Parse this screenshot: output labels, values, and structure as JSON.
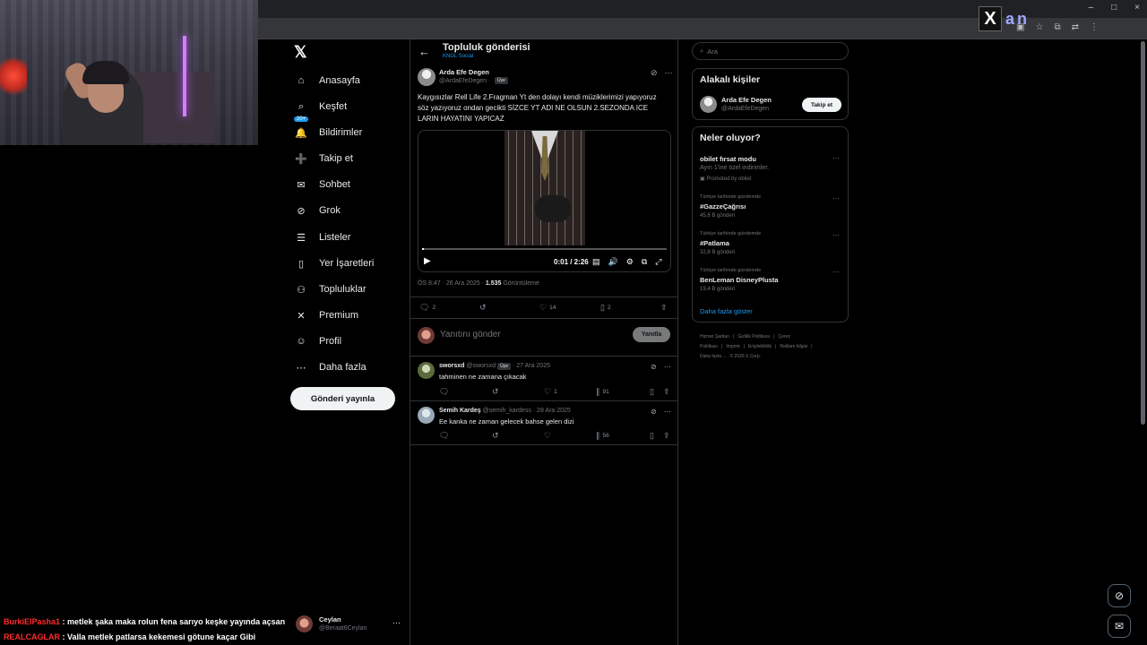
{
  "brand": {
    "xan_logo": "X",
    "xan_text": "an"
  },
  "window_controls": [
    "–",
    "□",
    "×"
  ],
  "ext_icons": [
    "▣",
    "☆",
    "⧉",
    "⇄",
    "⋮"
  ],
  "nav": {
    "logo": "𝕏",
    "items": [
      {
        "label": "Anasayfa",
        "icon": "home-icon",
        "glyph": "⌂"
      },
      {
        "label": "Keşfet",
        "icon": "search-icon",
        "glyph": "⌕"
      },
      {
        "label": "Bildirimler",
        "icon": "bell-icon",
        "glyph": "🔔",
        "badge": "20+"
      },
      {
        "label": "Takip et",
        "icon": "follow-icon",
        "glyph": "➕"
      },
      {
        "label": "Sohbet",
        "icon": "mail-icon",
        "glyph": "✉"
      },
      {
        "label": "Grok",
        "icon": "grok-icon",
        "glyph": "⊘"
      },
      {
        "label": "Listeler",
        "icon": "list-icon",
        "glyph": "☰"
      },
      {
        "label": "Yer İşaretleri",
        "icon": "bookmark-icon",
        "glyph": "▯"
      },
      {
        "label": "Topluluklar",
        "icon": "communities-icon",
        "glyph": "⚇"
      },
      {
        "label": "Premium",
        "icon": "x-premium-icon",
        "glyph": "✕"
      },
      {
        "label": "Profil",
        "icon": "profile-icon",
        "glyph": "☺"
      },
      {
        "label": "Daha fazla",
        "icon": "more-icon",
        "glyph": "⋯"
      }
    ],
    "post_button": "Gönderi yayınla"
  },
  "header": {
    "title": "Topluluk gönderisi",
    "community": "KNGL Social"
  },
  "tweet": {
    "author": "Arda Efe Degen",
    "handle": "@ArdaEfeDegen",
    "member_tag": "Üye",
    "text": "Kaygısızlar Rell Life 2.Fragman Yt den dolayı kendi müziklerimizi yapıyoruz söz yazıyoruz ondan gecikti SİZCE YT ADI NE OLSUN 2.SEZONDA ICE LARIN HAYATINI YAPICAZ",
    "video": {
      "time": "0:01 / 2:26",
      "progress_fraction": 0.007
    },
    "time": "ÖS 8:47 · 26 Ara 2025 · ",
    "views_count": "1.535",
    "views_label": " Görüntüleme",
    "stats": {
      "replies": "2",
      "retweets": "",
      "likes": "14",
      "bookmarks": "2"
    }
  },
  "reply_box": {
    "placeholder": "Yanıtını gönder",
    "button": "Yanıtla"
  },
  "replies": [
    {
      "name": "sworsxd",
      "handle": "@sworsxd",
      "tag": "Üye",
      "date": "· 27 Ara 2025",
      "text": "tahminen ne zamana çıkacak",
      "likes": "1",
      "views": "91"
    },
    {
      "name": "Semih Kardeş",
      "handle": "@semih_kardess",
      "tag": "",
      "date": "· 28 Ara 2025",
      "text": "Ee kanka ne zaman gelecek bahse gelen dizi",
      "likes": "",
      "views": "56"
    }
  ],
  "right": {
    "search_placeholder": "Ara",
    "related_title": "Alakalı kişiler",
    "related_user": {
      "name": "Arda Efe Degen",
      "handle": "@ArdaEfeDegen",
      "button": "Takip et"
    },
    "trends_title": "Neler oluyor?",
    "trends": [
      {
        "ctx": "",
        "name": "obilet fırsat modu",
        "desc": "Ayın 1'ine özel indirimler.",
        "count": "Promoted by obilet"
      },
      {
        "ctx": "Türkiye tarihinde gündemde",
        "name": "#GazzeÇağrısı",
        "desc": "",
        "count": "45,8 B gönderi"
      },
      {
        "ctx": "Türkiye tarihinde gündemde",
        "name": "#Patlama",
        "desc": "",
        "count": "32,8 B gönderi"
      },
      {
        "ctx": "Türkiye tarihinde gündemde",
        "name": "BenLeman DisneyPlusta",
        "desc": "",
        "count": "19,4 B gönderi"
      }
    ],
    "show_more": "Daha fazla göster",
    "footer": [
      "Hizmet Şartları",
      "|",
      "Gizlilik Politikası",
      "|",
      "Çerez Politikası",
      "|",
      "Imprint",
      "|",
      "Erişilebilirlik",
      "|",
      "Reklam bilgisi",
      "|",
      "Daha fazla ...",
      "© 2026 X Corp."
    ]
  },
  "chat": [
    {
      "user": "BurkiElPasha1",
      "msg": " : metlek şaka maka rolun fena sarıyo keşke yayında açsan"
    },
    {
      "user": "REALCAGLAR",
      "msg": " : Valla metlek patlarsa kekemesi götune kaçar Gibi"
    }
  ],
  "account": {
    "name": "Ceylan",
    "handle": "@Beraat6Ceylan",
    "more": "⋯"
  },
  "colors": {
    "accent": "#1d9bf0",
    "chat_user": "#ff2b2b",
    "bg": "#000000"
  }
}
